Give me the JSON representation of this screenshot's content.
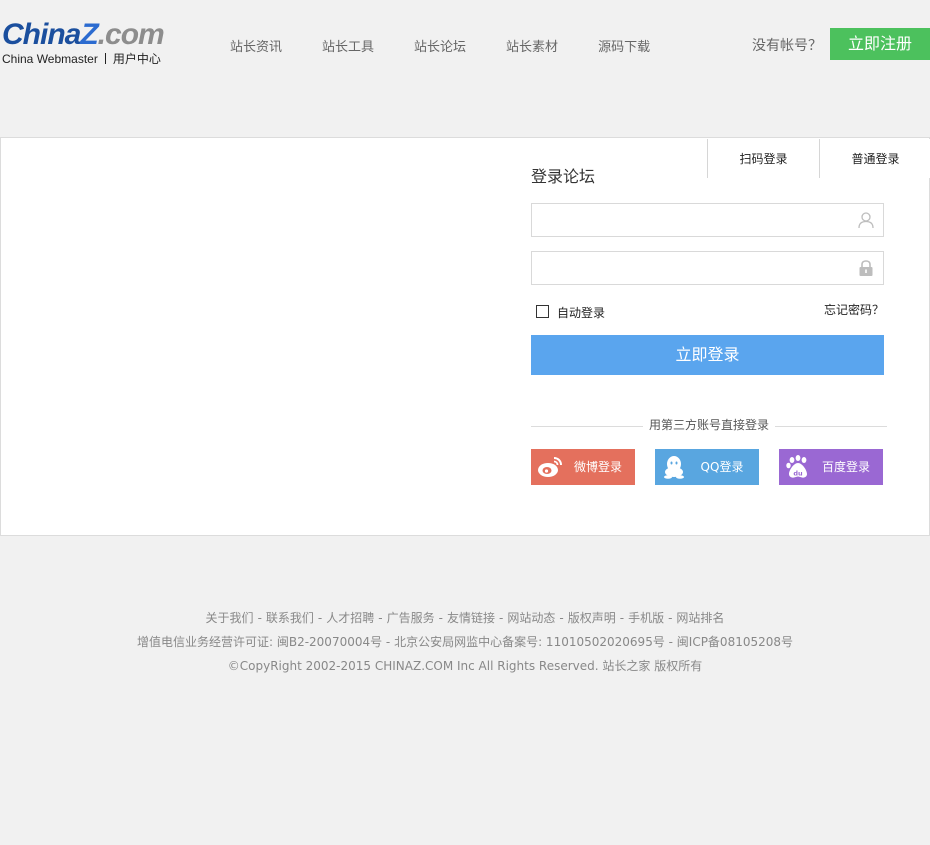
{
  "header": {
    "logo": {
      "part1": "China",
      "part2": "Z",
      "part3": ".com",
      "sub_brand": "China Webmaster",
      "sub_center": "用户中心"
    },
    "nav": [
      "站长资讯",
      "站长工具",
      "站长论坛",
      "站长素材",
      "源码下载"
    ],
    "no_account": "没有帐号？",
    "register_label": "立即注册"
  },
  "login": {
    "tabs": [
      "扫码登录",
      "普通登录"
    ],
    "title": "登录论坛",
    "username_value": "",
    "password_value": "",
    "auto_login_label": "自动登录",
    "auto_login_checked": false,
    "forgot_label": "忘记密码？",
    "submit_label": "立即登录",
    "third_party_label": "用第三方账号直接登录",
    "social": [
      {
        "id": "weibo",
        "label": "微博登录",
        "icon": "weibo-icon",
        "color": "#e4705d"
      },
      {
        "id": "qq",
        "label": "QQ登录",
        "icon": "qq-icon",
        "color": "#59a6e0"
      },
      {
        "id": "baidu",
        "label": "百度登录",
        "icon": "baidu-icon",
        "color": "#9a68d3"
      }
    ]
  },
  "footer": {
    "links": [
      "关于我们",
      "联系我们",
      "人才招聘",
      "广告服务",
      "友情链接",
      "网站动态",
      "版权声明",
      "手机版",
      "网站排名"
    ],
    "license": "增值电信业务经营许可证: 闽B2-20070004号 - 北京公安局网监中心备案号: 11010502020695号 - 闽ICP备08105208号",
    "copyright": "©CopyRight 2002-2015 CHINAZ.COM Inc All Rights Reserved. 站长之家 版权所有"
  },
  "colors": {
    "register": "#4cc15d",
    "login_button": "#5aa5ee",
    "background": "#f1f1f1"
  }
}
